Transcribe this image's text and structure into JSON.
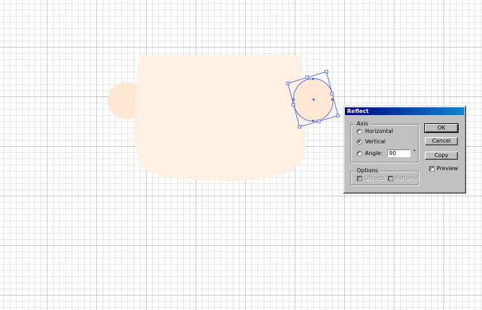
{
  "dialog": {
    "title": "Reflect",
    "axis_group": {
      "legend": "Axis",
      "horizontal_label": "Horizontal",
      "vertical_label": "Vertical",
      "angle_label": "Angle:",
      "angle_value": "90",
      "degree_symbol": "°",
      "selected": "vertical"
    },
    "options_group": {
      "legend": "Options",
      "objects_label": "Objects",
      "patterns_label": "Patterns"
    },
    "buttons": {
      "ok": "OK",
      "cancel": "Cancel",
      "copy": "Copy"
    },
    "preview_label": "Preview",
    "preview_checked": true
  },
  "artwork": {
    "cup_fill": "#fff0e4",
    "handle_fill": "#ffe7d6",
    "selected_shape_fill": "#ffe7d6",
    "selection_color": "#5a6ee0"
  }
}
